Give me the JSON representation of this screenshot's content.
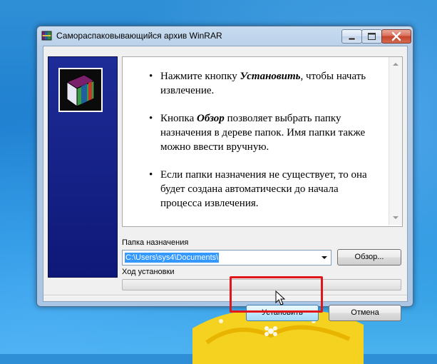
{
  "window": {
    "title": "Самораспаковывающийся архив WinRAR",
    "app_icon": "winrar-archive-icon"
  },
  "caption_buttons": {
    "minimize_icon": "minimize-icon",
    "maximize_icon": "maximize-icon",
    "close_icon": "close-icon"
  },
  "banner": {
    "logo_icon": "winrar-books-icon",
    "color": "#1a2a92"
  },
  "info": {
    "items": [
      {
        "before": "Нажмите кнопку ",
        "bold": "Установить",
        "after": ", чтобы начать извлечение."
      },
      {
        "before": "Кнопка ",
        "bold": "Обзор",
        "after": " позволяет выбрать папку назначения в дереве папок. Имя папки также можно ввести вручную."
      },
      {
        "before": "Если папки назначения не существует, то она будет создана автоматически до начала процесса извлечения.",
        "bold": "",
        "after": ""
      }
    ]
  },
  "destination": {
    "label": "Папка назначения",
    "value": "C:\\Users\\sys4\\Documents\\",
    "browse_label": "Обзор..."
  },
  "progress": {
    "label": "Ход установки",
    "value": 0,
    "color": "#37c042"
  },
  "actions": {
    "install_label": "Установить",
    "cancel_label": "Отмена"
  },
  "annotation": {
    "highlight_color": "#e0161b"
  },
  "colors": {
    "desktop": "#1e7fd0",
    "selection": "#3399ff"
  }
}
